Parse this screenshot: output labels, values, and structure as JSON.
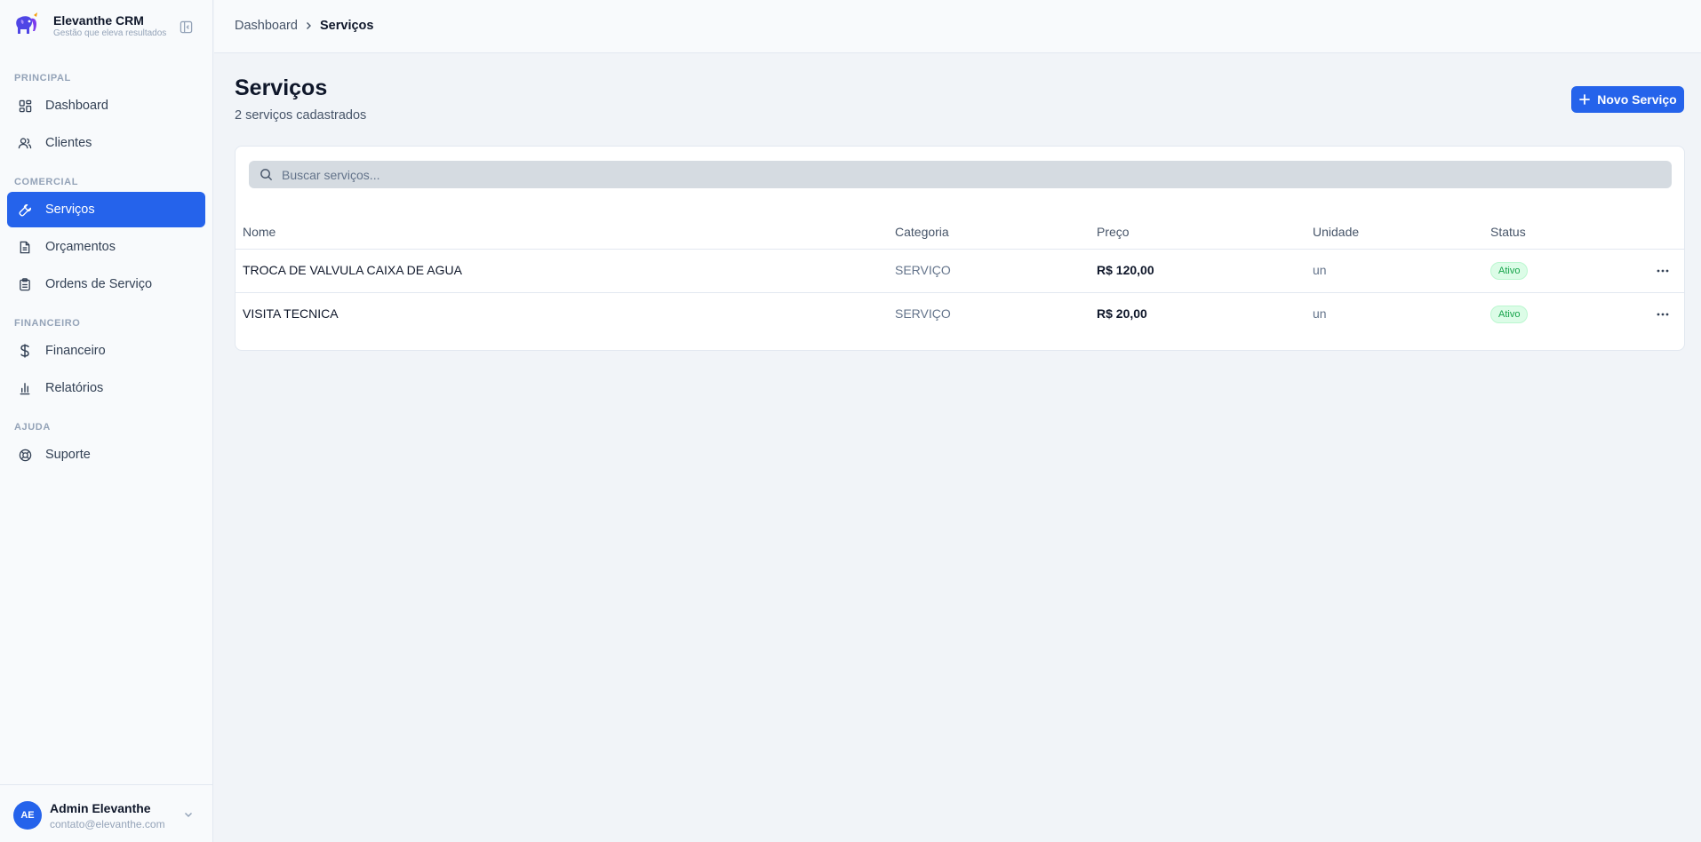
{
  "app": {
    "name": "Elevanthe CRM",
    "tagline": "Gestão que eleva resultados"
  },
  "sidebar": {
    "sections": [
      {
        "label": "PRINCIPAL"
      },
      {
        "label": "COMERCIAL"
      },
      {
        "label": "FINANCEIRO"
      },
      {
        "label": "AJUDA"
      }
    ],
    "items": [
      {
        "label": "Dashboard",
        "icon": "dashboard-grid-icon"
      },
      {
        "label": "Clientes",
        "icon": "users-icon"
      },
      {
        "label": "Serviços",
        "icon": "wrench-icon",
        "active": true
      },
      {
        "label": "Orçamentos",
        "icon": "document-icon"
      },
      {
        "label": "Ordens de Serviço",
        "icon": "clipboard-icon"
      },
      {
        "label": "Financeiro",
        "icon": "dollar-icon"
      },
      {
        "label": "Relatórios",
        "icon": "bar-chart-icon"
      },
      {
        "label": "Suporte",
        "icon": "lifebuoy-icon"
      }
    ]
  },
  "user": {
    "initials": "AE",
    "name": "Admin Elevanthe",
    "email": "contato@elevanthe.com"
  },
  "breadcrumb": {
    "home": "Dashboard",
    "current": "Serviços"
  },
  "page": {
    "title": "Serviços",
    "subtitle": "2 serviços cadastrados",
    "new_button": "Novo Serviço"
  },
  "search": {
    "placeholder": "Buscar serviços..."
  },
  "table": {
    "columns": [
      "Nome",
      "Categoria",
      "Preço",
      "Unidade",
      "Status"
    ],
    "rows": [
      {
        "nome": "TROCA DE VALVULA CAIXA DE AGUA",
        "categoria": "SERVIÇO",
        "preco": "R$ 120,00",
        "unidade": "un",
        "status": "Ativo"
      },
      {
        "nome": "VISITA TECNICA",
        "categoria": "SERVIÇO",
        "preco": "R$ 20,00",
        "unidade": "un",
        "status": "Ativo"
      }
    ]
  },
  "colors": {
    "accent": "#2563eb",
    "status_active_bg": "#dcfce7",
    "status_active_text": "#16a34a"
  }
}
